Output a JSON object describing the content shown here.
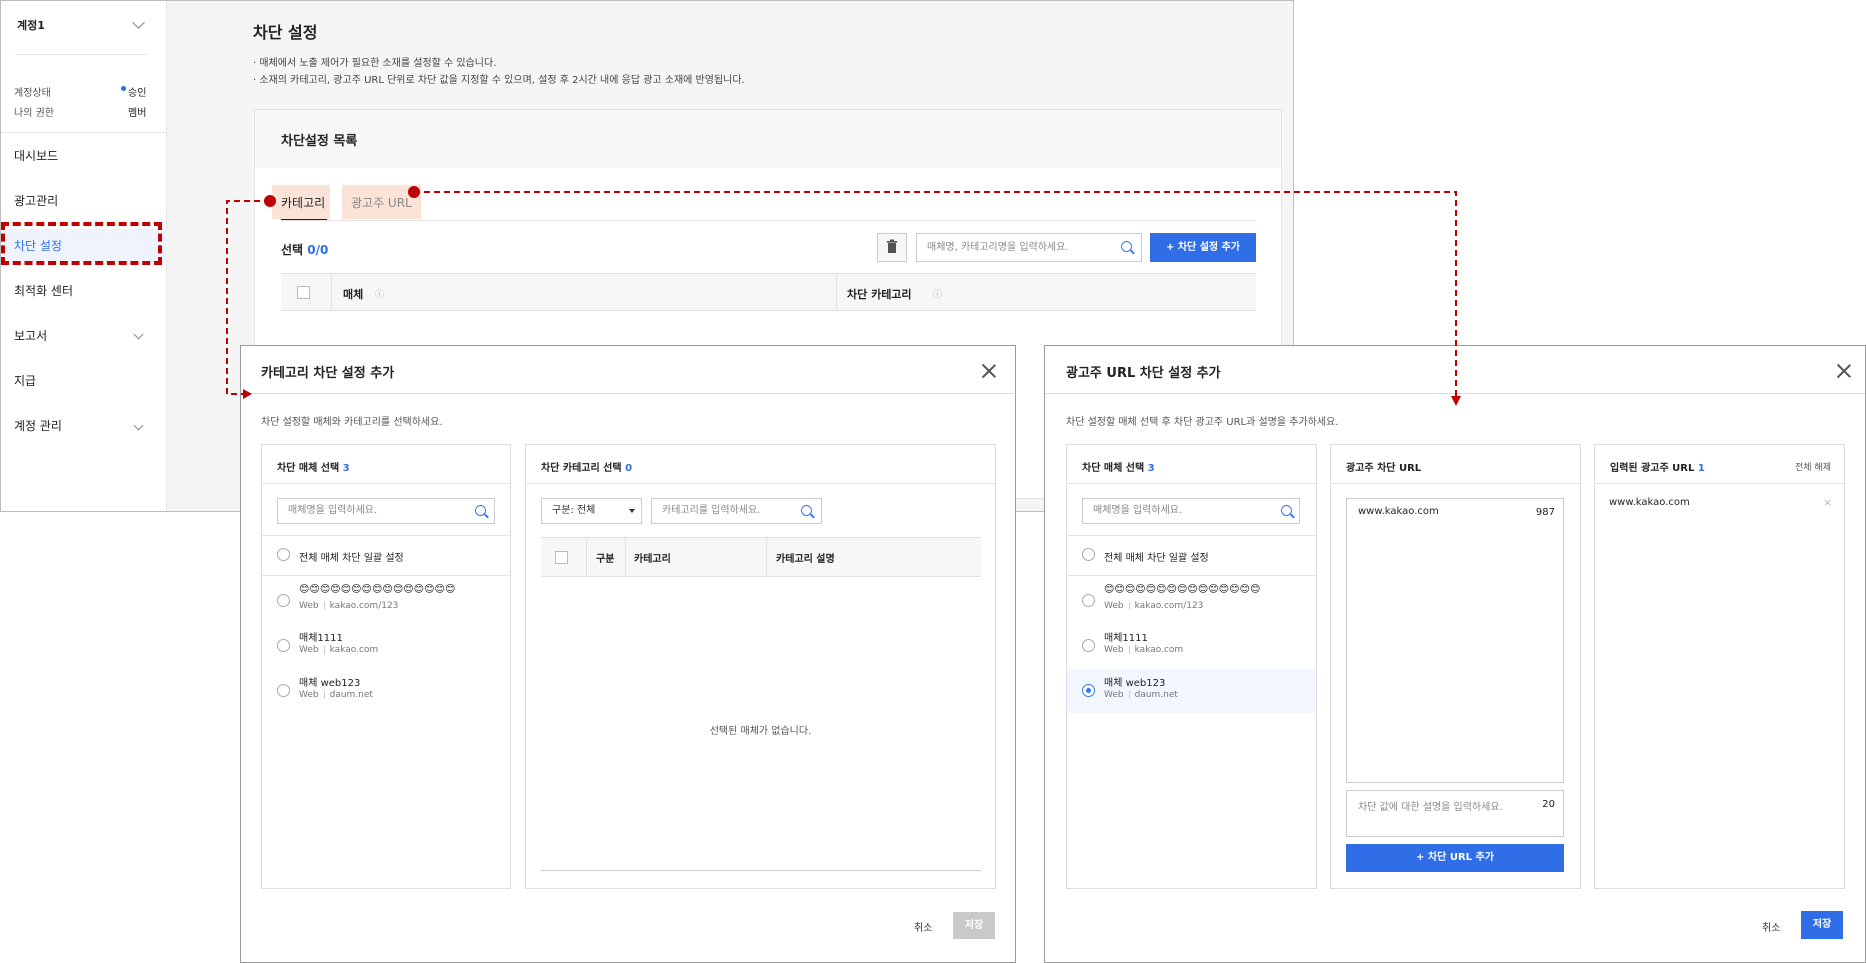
{
  "main": {
    "sidebar": {
      "account_name": "계정1",
      "status_label": "계정상태",
      "status_value": "승인",
      "role_label": "나의 권한",
      "role_value": "멤버",
      "items": [
        {
          "label": "대시보드"
        },
        {
          "label": "광고관리"
        },
        {
          "label": "차단 설정"
        },
        {
          "label": "최적화 센터"
        },
        {
          "label": "보고서"
        },
        {
          "label": "지급"
        },
        {
          "label": "계정 관리"
        }
      ]
    },
    "title": "차단 설정",
    "desc_lines": [
      "· 매체에서 노출 제어가 필요한 소재를 설정할 수 있습니다.",
      "· 소재의 카테고리, 광고주 URL 단위로 차단 값을 지정할 수 있으며, 설정 후 2시간 내에 응답 광고 소재에 반영됩니다."
    ],
    "list": {
      "title": "차단설정 목록",
      "tabs": [
        {
          "label": "카테고리"
        },
        {
          "label": "광고주 URL"
        }
      ],
      "selection_label": "선택",
      "selection_count": "0/0",
      "search_placeholder": "매체명, 카테고리명을 입력하세요.",
      "add_button": "+ 차단 설정 추가",
      "columns": [
        "매체",
        "차단 카테고리"
      ]
    }
  },
  "category_modal": {
    "title": "카테고리 차단 설정 추가",
    "instruction": "차단 설정할 매체와 카테고리를 선택하세요.",
    "media_col": {
      "header": "차단 매체 선택",
      "count": "3",
      "search_placeholder": "매체명을 입력하세요.",
      "all_option": "전체 매체 차단 일괄 설정",
      "items": [
        {
          "name": "😊😊😊😊😊😊😊😊😊😊😊😊😊😊😊",
          "type": "Web",
          "url": "kakao.com/123"
        },
        {
          "name": "매체1111",
          "type": "Web",
          "url": "kakao.com"
        },
        {
          "name": "매체 web123",
          "type": "Web",
          "url": "daum.net"
        }
      ]
    },
    "category_col": {
      "header": "차단 카테고리 선택",
      "count": "0",
      "filter_label": "구분: 전체",
      "search_placeholder": "카테고리를 입력하세요.",
      "columns": [
        "구분",
        "카테고리",
        "카테고리 설명"
      ],
      "empty_text": "선택된 매체가 없습니다."
    },
    "cancel": "취소",
    "save": "저장"
  },
  "url_modal": {
    "title": "광고주 URL 차단 설정 추가",
    "instruction": "차단 설정할 매체 선택 후 차단 광고주 URL과 설명을 추가하세요.",
    "media_col": {
      "header": "차단 매체 선택",
      "count": "3",
      "search_placeholder": "매체명을 입력하세요.",
      "all_option": "전체 매체 차단 일괄 설정",
      "items": [
        {
          "name": "😊😊😊😊😊😊😊😊😊😊😊😊😊😊😊",
          "type": "Web",
          "url": "kakao.com/123"
        },
        {
          "name": "매체1111",
          "type": "Web",
          "url": "kakao.com"
        },
        {
          "name": "매체 web123",
          "type": "Web",
          "url": "daum.net",
          "selected": true
        }
      ]
    },
    "url_col": {
      "header": "광고주 차단 URL",
      "url_value": "www.kakao.com",
      "url_counter": "987",
      "desc_placeholder": "차단 값에 대한 설명을 입력하세요.",
      "desc_counter": "20",
      "add_button": "+ 차단 URL 추가"
    },
    "entered_col": {
      "header": "입력된 광고주 URL",
      "count": "1",
      "clear_all": "전체 해제",
      "items": [
        {
          "url": "www.kakao.com"
        }
      ]
    },
    "cancel": "취소",
    "save": "저장"
  },
  "colors": {
    "accent": "#2f6ee6",
    "annotation_red": "#c00000",
    "tab_highlight": "#fbe3d8"
  }
}
